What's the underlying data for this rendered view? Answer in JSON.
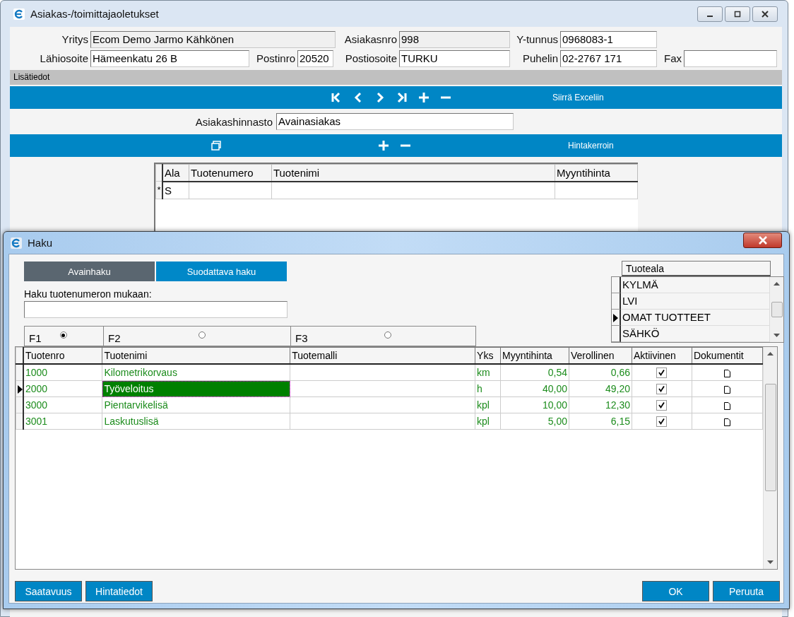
{
  "main_window": {
    "title": "Asiakas-/toimittajaoletukset",
    "fields": [
      [
        {
          "label": "Yritys",
          "value": "Ecom Demo Jarmo Kähkönen",
          "readonly": true
        },
        {
          "label": "Asiakasnro",
          "value": "998",
          "readonly": true
        },
        {
          "label": "Y-tunnus",
          "value": "0968083-1",
          "readonly": false
        }
      ],
      [
        {
          "label": "Lähiosoite",
          "value": "Hämeenkatu 26 B",
          "readonly": false
        },
        {
          "label": "Postinro",
          "value": "20520",
          "readonly": false
        },
        {
          "label": "Postiosoite",
          "value": "TURKU",
          "readonly": false
        },
        {
          "label": "Puhelin",
          "value": "02-2767 171",
          "readonly": false
        },
        {
          "label": "Fax",
          "readonly": false
        }
      ]
    ],
    "section_label": "Lisätiedot",
    "export_button": "Siirrä Exceliin",
    "price_list": {
      "label": "Asiakashinnasto",
      "value": "Avainasiakas"
    },
    "factor_button": "Hintakerroin",
    "grid": {
      "columns": [
        "Ala",
        "Tuotenumero",
        "Tuotenimi",
        "Myyntihinta"
      ],
      "rows": [
        {
          "marker": "*",
          "ala": "S"
        }
      ]
    }
  },
  "dialog": {
    "title": "Haku",
    "tabs": [
      {
        "label": "Avainhaku",
        "selected": false
      },
      {
        "label": "Suodattava haku",
        "selected": true
      }
    ],
    "search": {
      "label": "Haku tuotenumeron mukaan:"
    },
    "key_options": [
      {
        "label": "F1",
        "selected": true
      },
      {
        "label": "F2",
        "selected": false
      },
      {
        "label": "F3",
        "selected": false
      }
    ],
    "category_list": {
      "header": "Tuoteala",
      "items": [
        {
          "label": "KYLMÄ",
          "selected": false
        },
        {
          "label": "LVI",
          "selected": false
        },
        {
          "label": "OMAT TUOTTEET",
          "selected": true
        },
        {
          "label": "SÄHKÖ",
          "selected": false
        }
      ]
    },
    "results": {
      "columns": [
        "Tuotenro",
        "Tuotenimi",
        "Tuotemalli",
        "Yks",
        "Myyntihinta",
        "Verollinen",
        "Aktiivinen",
        "Dokumentit"
      ],
      "rows": [
        {
          "number": "1000",
          "name": "Kilometrikorvaus",
          "unit": "km",
          "price": "0,54",
          "gross": "0,66",
          "active": true,
          "selected": false
        },
        {
          "number": "2000",
          "name": "Työveloitus",
          "unit": "h",
          "price": "40,00",
          "gross": "49,20",
          "active": true,
          "selected": true
        },
        {
          "number": "3000",
          "name": "Pientarvikelisä",
          "unit": "kpl",
          "price": "10,00",
          "gross": "12,30",
          "active": true,
          "selected": false
        },
        {
          "number": "3001",
          "name": "Laskutuslisä",
          "unit": "kpl",
          "price": "5,00",
          "gross": "6,15",
          "active": true,
          "selected": false
        }
      ]
    },
    "left_buttons": [
      "Saatavuus",
      "Hintatiedot"
    ],
    "right_buttons": [
      "OK",
      "Peruuta"
    ]
  }
}
